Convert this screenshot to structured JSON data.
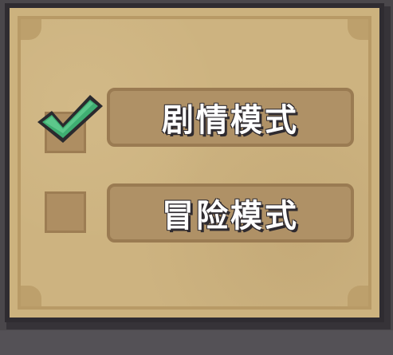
{
  "menu": {
    "options": [
      {
        "label": "剧情模式",
        "checked": true
      },
      {
        "label": "冒险模式",
        "checked": false
      }
    ]
  },
  "colors": {
    "background": "#4a474b",
    "panel": "#cdb380",
    "button": "#af9166",
    "check": "#3fae72",
    "text": "#ffffff",
    "outline": "#2e2a2f"
  },
  "icons": {
    "check": "checkmark-icon"
  }
}
